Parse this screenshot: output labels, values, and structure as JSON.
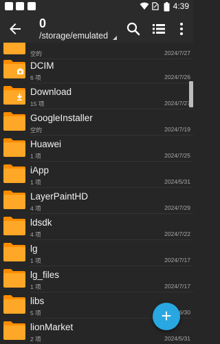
{
  "status_bar": {
    "time": "4:39"
  },
  "app_bar": {
    "title": "0",
    "path": "/storage/emulated"
  },
  "files": [
    {
      "name": "",
      "info": "空的",
      "date": "2024/7/27",
      "badge": ""
    },
    {
      "name": "DCIM",
      "info": "6 项",
      "date": "2024/7/26",
      "badge": "camera"
    },
    {
      "name": "Download",
      "info": "15 项",
      "date": "2024/7/27",
      "badge": "download"
    },
    {
      "name": "GoogleInstaller",
      "info": "空的",
      "date": "2024/7/19",
      "badge": ""
    },
    {
      "name": "Huawei",
      "info": "1 项",
      "date": "2024/7/25",
      "badge": ""
    },
    {
      "name": "iApp",
      "info": "1 项",
      "date": "2024/5/31",
      "badge": ""
    },
    {
      "name": "LayerPaintHD",
      "info": "4 项",
      "date": "2024/7/29",
      "badge": ""
    },
    {
      "name": "ldsdk",
      "info": "4 项",
      "date": "2024/7/22",
      "badge": ""
    },
    {
      "name": "lg",
      "info": "1 项",
      "date": "2024/7/17",
      "badge": ""
    },
    {
      "name": "lg_files",
      "info": "1 项",
      "date": "2024/7/17",
      "badge": ""
    },
    {
      "name": "libs",
      "info": "5 项",
      "date": "2024/6/30",
      "badge": ""
    },
    {
      "name": "lionMarket",
      "info": "2 项",
      "date": "2024/5/31",
      "badge": ""
    }
  ],
  "fab": {
    "label": "+"
  },
  "colors": {
    "folder": "#ffa726",
    "folder_tab": "#fb8c00",
    "fab": "#29a7e1",
    "background": "#262626"
  },
  "icons": [
    "back-arrow-icon",
    "search-icon",
    "list-view-icon",
    "more-vert-icon",
    "folder-icon",
    "camera-icon",
    "download-icon",
    "add-icon"
  ]
}
